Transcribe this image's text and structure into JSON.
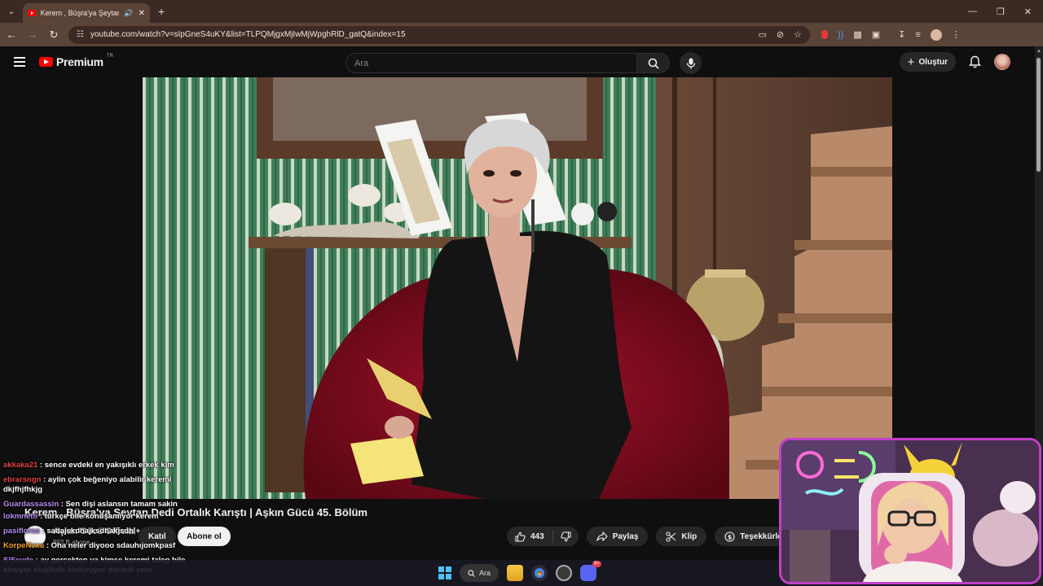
{
  "browser": {
    "tab_title": "Kerem , Büşra'ya Şeytan Dedi",
    "url": "youtube.com/watch?v=sIpGneS4uKY&list=TLPQMjgxMjIwMjWpghRlD_gatQ&index=15"
  },
  "masthead": {
    "logo_text": "Premium",
    "region": "TR",
    "search_placeholder": "Ara",
    "create_label": "Oluştur"
  },
  "video": {
    "title": "Kerem , Büşra'ya Şeytan Dedi Ortalık Karıştı | Aşkın Gücü 45. Bölüm",
    "channel_name": "Aşkın Gücü Official",
    "channel_subs": "802 B abone",
    "join_label": "Katıl",
    "subscribe_label": "Abone ol",
    "like_count": "443",
    "share_label": "Paylaş",
    "clip_label": "Klip",
    "thanks_label": "Teşekkürler"
  },
  "chat": [
    {
      "user": "akkaka21",
      "color": "#e04343",
      "text": ": sence evdeki en yakışıklı erkek kim"
    },
    {
      "user": "ebrarsngn",
      "color": "#e04343",
      "text": ": aylin çok beğeniyo alabilir keremi dkjfhjfhkjg"
    },
    {
      "user": "Guardassassin",
      "color": "#b68cf0",
      "text": ": Sen dişi aslansın tamam sakin"
    },
    {
      "user": "lokmneto",
      "color": "#b68cf0",
      "text": ": türkçe bile konuşamıyor kerem"
    },
    {
      "user": "pasifloras",
      "color": "#b68cf0",
      "text": ": sadajskdhajksdhakjsdh +"
    },
    {
      "user": "KorpeNexa",
      "color": "#f0a030",
      "text": ": Oha neler diyooo sdauhıjomkpasf"
    },
    {
      "user": "SlSevde",
      "color": "#b68cf0",
      "text": ": ay gerçekten ya kimse keremi talep bile etmiyor skdjfsdh kuduruyor durduk yere"
    }
  ],
  "taskbar": {
    "search_label": "Ara",
    "discord_badge": "9+"
  }
}
